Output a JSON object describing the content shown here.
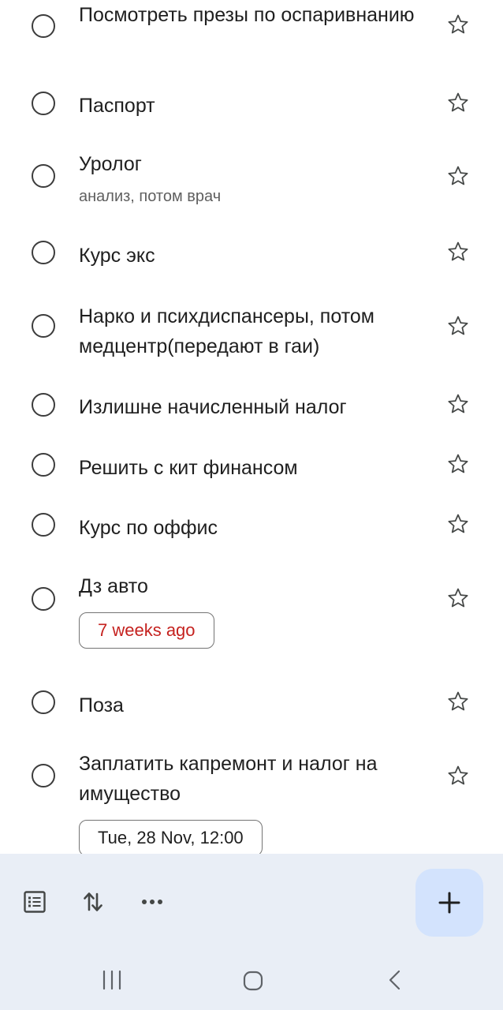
{
  "tasks": [
    {
      "title": "Посмотреть презы по оспаривнанию"
    },
    {
      "title": "Паспорт"
    },
    {
      "title": "Уролог",
      "note": "анализ, потом врач"
    },
    {
      "title": "Курс экс"
    },
    {
      "title": "Нарко и психдиспансеры, потом медцентр(передают в гаи)"
    },
    {
      "title": "Излишне начисленный налог"
    },
    {
      "title": "Решить с кит финансом"
    },
    {
      "title": "Курс по оффис"
    },
    {
      "title": "Дз авто",
      "chip": "7 weeks ago",
      "chip_status": "overdue"
    },
    {
      "title": "Поза"
    },
    {
      "title": "Заплатить капремонт и налог на имущество",
      "chip": "Tue, 28 Nov, 12:00"
    }
  ],
  "bottom_bar": {
    "icons": [
      "list-view-icon",
      "sort-icon",
      "more-icon"
    ],
    "fab_icon": "plus-icon"
  },
  "system_nav": [
    "recents-icon",
    "home-icon",
    "back-icon"
  ],
  "colors": {
    "overdue": "#c5221f",
    "bottom_bar_bg": "#e9eef6",
    "fab_bg": "#d3e3fd"
  }
}
